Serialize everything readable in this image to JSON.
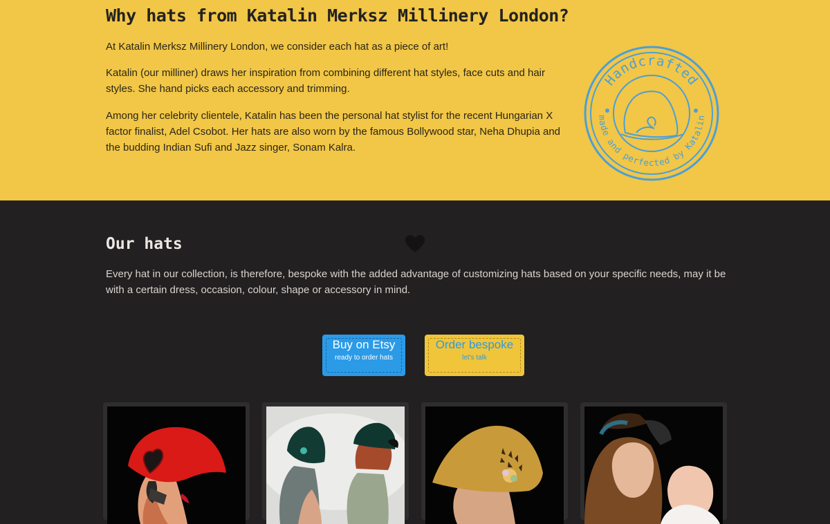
{
  "why_section": {
    "title": "Why hats from Katalin Merksz Millinery London?",
    "paragraphs": [
      "At Katalin Merksz Millinery London, we consider each hat as a piece of art!",
      "Katalin (our milliner) draws her inspiration from combining different hat styles, face cuts and hair styles. She hand picks each accessory and trimming.",
      "Among her celebrity clientele, Katalin has been the personal hat stylist for the recent Hungarian X factor finalist, Adel Csobot. Her hats are also worn by the famous Bollywood star, Neha Dhupia and the budding Indian Sufi and Jazz singer, Sonam Kalra."
    ],
    "stamp": {
      "top_text": "Handcrafted",
      "bottom_text": "made and perfected by Katalin",
      "color": "#4a9fd8"
    },
    "background_color": "#f2c646"
  },
  "hats_section": {
    "title": "Our hats",
    "intro": "Every hat in our collection, is therefore, bespoke with the added advantage of customizing hats based on your specific needs, may it be with a certain dress, occasion, colour, shape or accessory in mind.",
    "background_color": "#222021",
    "buttons": [
      {
        "label": "Buy on Etsy",
        "sublabel": "ready to order hats",
        "color": "#2b9be8"
      },
      {
        "label": "Order bespoke",
        "sublabel": "let's talk",
        "color": "#f0c53a"
      }
    ],
    "gallery": [
      {
        "icon": "red-heart-hat-photo"
      },
      {
        "icon": "green-cloche-hats-photo"
      },
      {
        "icon": "mustard-cloche-hat-photo"
      },
      {
        "icon": "mother-and-baby-veil-hat-photo"
      }
    ]
  }
}
